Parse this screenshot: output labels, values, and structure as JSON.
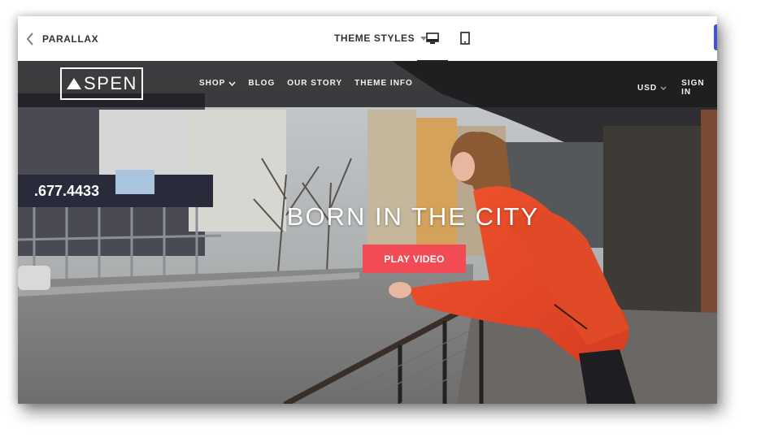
{
  "toolbar": {
    "back_label": "PARALLAX",
    "theme_styles_label": "THEME STYLES",
    "devices": [
      "desktop-icon",
      "tablet-icon"
    ],
    "active_device": "desktop"
  },
  "site": {
    "logo_text": "SPEN",
    "nav": {
      "links": [
        "SHOP",
        "BLOG",
        "OUR STORY",
        "THEME INFO"
      ],
      "currency": "USD",
      "signin": "SIGN IN"
    },
    "hero": {
      "headline": "BORN IN THE CITY",
      "button_label": "PLAY VIDEO",
      "storefront_sign": ".677.4433"
    }
  },
  "colors": {
    "accent_button": "#f24b55",
    "nav_background": "#1c1c1e",
    "editor_edge_tab": "#3f55c9"
  }
}
